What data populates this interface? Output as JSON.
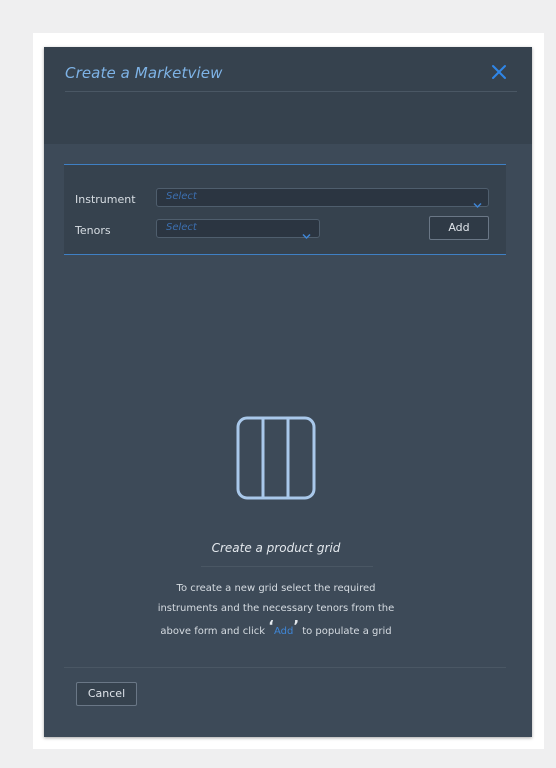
{
  "modal": {
    "title": "Create a Marketview",
    "close_icon": "close-icon",
    "accent_color": "#3f86d6"
  },
  "form": {
    "instrument_label": "Instrument",
    "instrument_placeholder": "Select",
    "tenors_label": "Tenors",
    "tenors_placeholder": "Select",
    "add_button": "Add",
    "dropdown_icon": "chevron-down-icon"
  },
  "empty_state": {
    "icon": "grid-columns-icon",
    "title": "Create a product grid",
    "line1": "To create a new grid select the required",
    "line2": "instruments and the necessary tenors from the",
    "line3_before": "above form  and click ",
    "open_quote": "‘",
    "add_word": "Add",
    "close_quote": "’",
    "line3_after": " to populate a grid"
  },
  "footer": {
    "cancel_button": "Cancel"
  }
}
